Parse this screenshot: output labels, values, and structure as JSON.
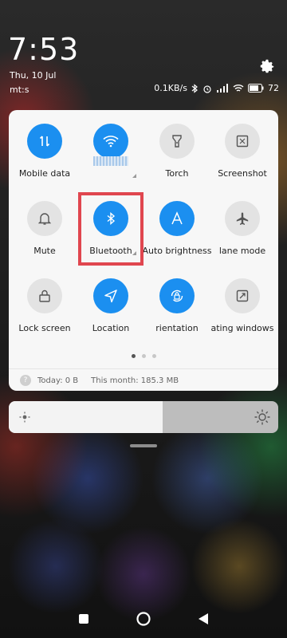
{
  "status": {
    "time": "7:53",
    "date": "Thu, 10 Jul",
    "carrier": "mt:s",
    "net_speed": "0.1KB/s",
    "battery": "72"
  },
  "tiles": [
    {
      "label": "Mobile data",
      "icon": "mobile-data-icon",
      "state": "on"
    },
    {
      "label": "",
      "icon": "wifi-icon",
      "state": "on"
    },
    {
      "label": "Torch",
      "icon": "torch-icon",
      "state": "off"
    },
    {
      "label": "Screenshot",
      "icon": "screenshot-icon",
      "state": "off"
    },
    {
      "label": "Mute",
      "icon": "bell-icon",
      "state": "off"
    },
    {
      "label": "Bluetooth",
      "icon": "bluetooth-icon",
      "state": "on"
    },
    {
      "label": "Auto brightness",
      "icon": "auto-brightness-icon",
      "state": "on"
    },
    {
      "label": "lane mode",
      "icon": "airplane-icon",
      "state": "off"
    },
    {
      "label": "Lock screen",
      "icon": "lock-icon",
      "state": "off"
    },
    {
      "label": "Location",
      "icon": "location-icon",
      "state": "on"
    },
    {
      "label": "rientation",
      "icon": "rotation-lock-icon",
      "state": "on"
    },
    {
      "label": "ating windows",
      "icon": "floating-window-icon",
      "state": "off"
    }
  ],
  "usage": {
    "today": "Today: 0 B",
    "month": "This month: 185.3 MB"
  },
  "brightness": {
    "level_fraction": 0.57
  },
  "colors": {
    "accent": "#1b8ff0",
    "highlight": "#e0464f"
  }
}
